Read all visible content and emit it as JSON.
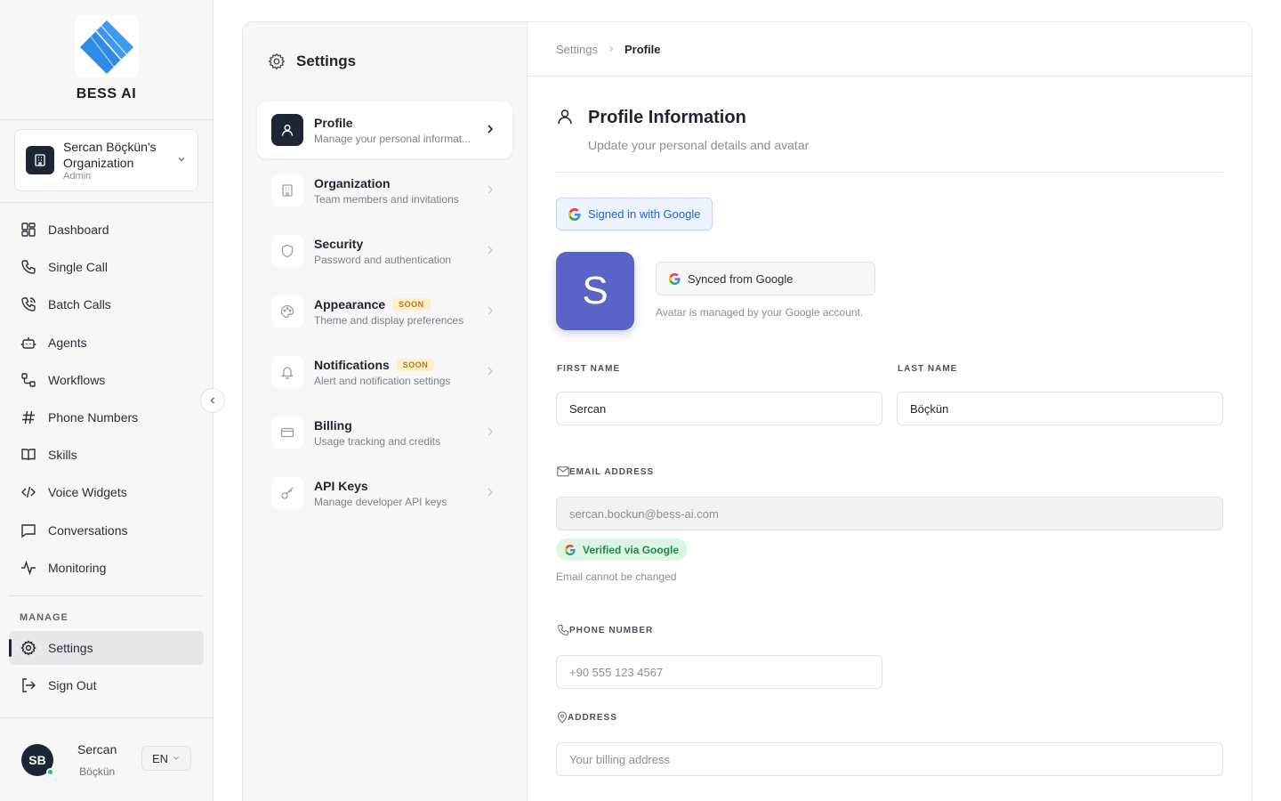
{
  "brand": {
    "name": "BESS AI"
  },
  "org": {
    "name_line1": "Sercan Böçkün's",
    "name_line2": "Organization",
    "role": "Admin"
  },
  "nav": {
    "items": [
      {
        "label": "Dashboard",
        "icon": "dashboard-icon"
      },
      {
        "label": "Single Call",
        "icon": "phone-icon"
      },
      {
        "label": "Batch Calls",
        "icon": "phone-batch-icon"
      },
      {
        "label": "Agents",
        "icon": "bot-icon"
      },
      {
        "label": "Workflows",
        "icon": "workflow-icon"
      },
      {
        "label": "Phone Numbers",
        "icon": "hash-icon"
      },
      {
        "label": "Skills",
        "icon": "book-icon"
      },
      {
        "label": "Voice Widgets",
        "icon": "code-icon"
      },
      {
        "label": "Conversations",
        "icon": "chat-icon"
      },
      {
        "label": "Monitoring",
        "icon": "activity-icon"
      }
    ],
    "manage_label": "MANAGE",
    "settings_label": "Settings",
    "signout_label": "Sign Out"
  },
  "user": {
    "initials": "SB",
    "first": "Sercan",
    "last": "Böçkün",
    "lang": "EN"
  },
  "settings": {
    "title": "Settings",
    "items": [
      {
        "label": "Profile",
        "desc": "Manage your personal informat...",
        "badge": ""
      },
      {
        "label": "Organization",
        "desc": "Team members and invitations",
        "badge": ""
      },
      {
        "label": "Security",
        "desc": "Password and authentication",
        "badge": ""
      },
      {
        "label": "Appearance",
        "desc": "Theme and display preferences",
        "badge": "SOON"
      },
      {
        "label": "Notifications",
        "desc": "Alert and notification settings",
        "badge": "SOON"
      },
      {
        "label": "Billing",
        "desc": "Usage tracking and credits",
        "badge": ""
      },
      {
        "label": "API Keys",
        "desc": "Manage developer API keys",
        "badge": ""
      }
    ]
  },
  "breadcrumb": {
    "root": "Settings",
    "current": "Profile"
  },
  "profile": {
    "title": "Profile Information",
    "subtitle": "Update your personal details and avatar",
    "google_badge": "Signed in with Google",
    "avatar_letter": "S",
    "synced_label": "Synced from Google",
    "avatar_note": "Avatar is managed by your Google account.",
    "first_name_label": "FIRST NAME",
    "first_name_value": "Sercan",
    "last_name_label": "LAST NAME",
    "last_name_value": "Böçkün",
    "email_label": "EMAIL ADDRESS",
    "email_value": "sercan.bockun@bess-ai.com",
    "verified_label": "Verified via Google",
    "email_note": "Email cannot be changed",
    "phone_label": "PHONE NUMBER",
    "phone_placeholder": "+90 555 123 4567",
    "address_label": "ADDRESS",
    "address_placeholder": "Your billing address"
  },
  "colors": {
    "accent": "#1e2636",
    "avatar": "#5b63c7",
    "google_blue": "#2563c9",
    "verified_green": "#1d8a4a",
    "soon": "#b7791f"
  }
}
